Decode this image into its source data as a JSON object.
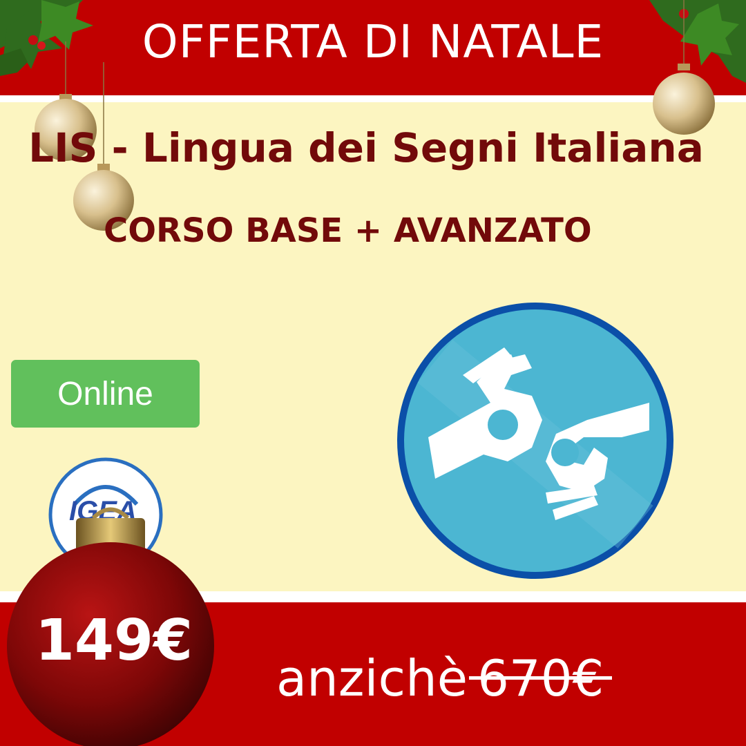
{
  "header": {
    "headline": "OFFERTA DI NATALE"
  },
  "course": {
    "title": "LIS - Lingua dei Segni Italiana",
    "subtitle": "CORSO BASE + AVANZATO",
    "mode_badge": "Online"
  },
  "logo": {
    "text": "IGEA"
  },
  "pricing": {
    "price": "149€",
    "compare_prefix": "anzichè",
    "old_price": "670€"
  },
  "icons": [
    "holly-branch-icon",
    "christmas-bauble-icon",
    "sign-language-hands-icon"
  ],
  "colors": {
    "band_red": "#c10000",
    "cream": "#fcf5c1",
    "title_maroon": "#720a0a",
    "online_green": "#61c05c",
    "badge_blue": "#4cb6d2",
    "badge_ring": "#0b4fa8"
  }
}
